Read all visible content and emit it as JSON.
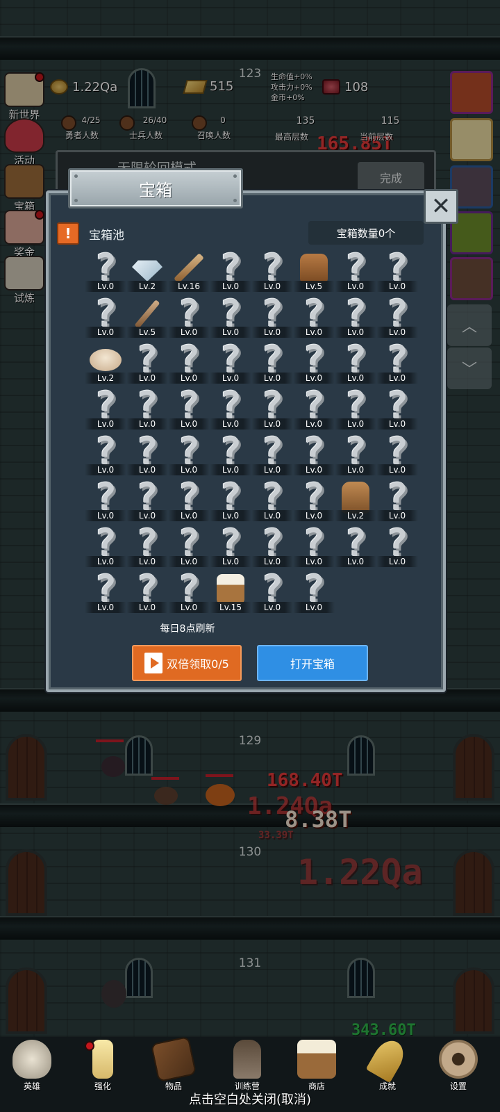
{
  "hud": {
    "coins": "1.22Qa",
    "gold": "515",
    "meat": "108",
    "bonus_lines": [
      "生命值+0%",
      "攻击力+0%",
      "金币+0%"
    ],
    "counts": [
      {
        "value": "4/25",
        "label": "勇者人数"
      },
      {
        "value": "26/40",
        "label": "士兵人数"
      },
      {
        "value": "0",
        "label": "召唤人数"
      }
    ],
    "max_floor": {
      "value": "135",
      "label": "最高层数"
    },
    "current_floor_value": "115",
    "current_floor_label": "当前层数"
  },
  "left_menu": [
    {
      "label": "新世界",
      "color": "#d7c7a1"
    },
    {
      "label": "活动",
      "color": "#c73a48"
    },
    {
      "label": "宝箱",
      "color": "#9a6b3a"
    },
    {
      "label": "奖金",
      "color": "#d8a596"
    },
    {
      "label": "试炼",
      "color": "#cfc8b7"
    }
  ],
  "behind_panel": {
    "title": "无限轮回模式",
    "button": "完成"
  },
  "dialog": {
    "title": "宝箱",
    "pool_label": "宝箱池",
    "warn_symbol": "!",
    "chest_count": "宝箱数量0个",
    "refresh_note": "每日8点刷新",
    "double_claim": "双倍领取0/5",
    "open_chest": "打开宝箱",
    "close_symbol": "✕"
  },
  "chest_pool": [
    {
      "item": "unknown",
      "level": "Lv.0"
    },
    {
      "item": "diamond",
      "level": "Lv.2"
    },
    {
      "item": "sword",
      "level": "Lv.16"
    },
    {
      "item": "unknown",
      "level": "Lv.0"
    },
    {
      "item": "unknown",
      "level": "Lv.0"
    },
    {
      "item": "leather-armor",
      "level": "Lv.5"
    },
    {
      "item": "unknown",
      "level": "Lv.0"
    },
    {
      "item": "unknown",
      "level": "Lv.0"
    },
    {
      "item": "unknown",
      "level": "Lv.0"
    },
    {
      "item": "dagger",
      "level": "Lv.5"
    },
    {
      "item": "unknown",
      "level": "Lv.0"
    },
    {
      "item": "unknown",
      "level": "Lv.0"
    },
    {
      "item": "unknown",
      "level": "Lv.0"
    },
    {
      "item": "unknown",
      "level": "Lv.0"
    },
    {
      "item": "unknown",
      "level": "Lv.0"
    },
    {
      "item": "unknown",
      "level": "Lv.0"
    },
    {
      "item": "bread",
      "level": "Lv.2"
    },
    {
      "item": "unknown",
      "level": "Lv.0"
    },
    {
      "item": "unknown",
      "level": "Lv.0"
    },
    {
      "item": "unknown",
      "level": "Lv.0"
    },
    {
      "item": "unknown",
      "level": "Lv.0"
    },
    {
      "item": "unknown",
      "level": "Lv.0"
    },
    {
      "item": "unknown",
      "level": "Lv.0"
    },
    {
      "item": "unknown",
      "level": "Lv.0"
    },
    {
      "item": "unknown",
      "level": "Lv.0"
    },
    {
      "item": "unknown",
      "level": "Lv.0"
    },
    {
      "item": "unknown",
      "level": "Lv.0"
    },
    {
      "item": "unknown",
      "level": "Lv.0"
    },
    {
      "item": "unknown",
      "level": "Lv.0"
    },
    {
      "item": "unknown",
      "level": "Lv.0"
    },
    {
      "item": "unknown",
      "level": "Lv.0"
    },
    {
      "item": "unknown",
      "level": "Lv.0"
    },
    {
      "item": "unknown",
      "level": "Lv.0"
    },
    {
      "item": "unknown",
      "level": "Lv.0"
    },
    {
      "item": "unknown",
      "level": "Lv.0"
    },
    {
      "item": "unknown",
      "level": "Lv.0"
    },
    {
      "item": "unknown",
      "level": "Lv.0"
    },
    {
      "item": "unknown",
      "level": "Lv.0"
    },
    {
      "item": "unknown",
      "level": "Lv.0"
    },
    {
      "item": "unknown",
      "level": "Lv.0"
    },
    {
      "item": "unknown",
      "level": "Lv.0"
    },
    {
      "item": "unknown",
      "level": "Lv.0"
    },
    {
      "item": "unknown",
      "level": "Lv.0"
    },
    {
      "item": "unknown",
      "level": "Lv.0"
    },
    {
      "item": "unknown",
      "level": "Lv.0"
    },
    {
      "item": "unknown",
      "level": "Lv.0"
    },
    {
      "item": "backpack",
      "level": "Lv.2"
    },
    {
      "item": "unknown",
      "level": "Lv.0"
    },
    {
      "item": "unknown",
      "level": "Lv.0"
    },
    {
      "item": "unknown",
      "level": "Lv.0"
    },
    {
      "item": "unknown",
      "level": "Lv.0"
    },
    {
      "item": "unknown",
      "level": "Lv.0"
    },
    {
      "item": "unknown",
      "level": "Lv.0"
    },
    {
      "item": "unknown",
      "level": "Lv.0"
    },
    {
      "item": "unknown",
      "level": "Lv.0"
    },
    {
      "item": "unknown",
      "level": "Lv.0"
    },
    {
      "item": "unknown",
      "level": "Lv.0"
    },
    {
      "item": "unknown",
      "level": "Lv.0"
    },
    {
      "item": "unknown",
      "level": "Lv.0"
    },
    {
      "item": "beer-mug",
      "level": "Lv.15"
    },
    {
      "item": "unknown",
      "level": "Lv.0"
    },
    {
      "item": "unknown",
      "level": "Lv.0"
    }
  ],
  "floors": {
    "top": "123",
    "mid": "129",
    "lower": "130",
    "bottom": "131"
  },
  "damage_numbers": [
    "165.85T",
    "168.40T",
    "1.24Qa",
    "8.38T",
    "33.39T",
    "1.22Qa",
    "343.60T"
  ],
  "bottom_nav": [
    {
      "label": "英雄",
      "icon": "skull-icon"
    },
    {
      "label": "强化",
      "icon": "candle-icon"
    },
    {
      "label": "物品",
      "icon": "book-icon"
    },
    {
      "label": "训练营",
      "icon": "lantern-icon"
    },
    {
      "label": "商店",
      "icon": "mug-icon"
    },
    {
      "label": "成就",
      "icon": "key-icon"
    },
    {
      "label": "设置",
      "icon": "gear-icon"
    }
  ],
  "close_hint": "点击空白处关闭(取消)",
  "colors": {
    "accent_orange": "#e06a22",
    "accent_blue": "#2f8fe4",
    "panel_bg": "#2a3946",
    "damage_red": "#e23a3a"
  }
}
